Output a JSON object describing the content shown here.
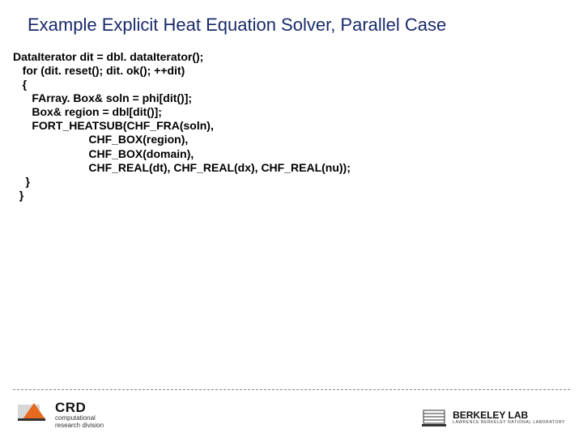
{
  "title": "Example Explicit Heat Equation Solver, Parallel Case",
  "code": {
    "l1": "DataIterator dit = dbl. dataIterator();",
    "l2": "   for (dit. reset(); dit. ok(); ++dit)",
    "l3": "   {",
    "l4": "      FArray. Box& soln = phi[dit()];",
    "l5": "      Box& region = dbl[dit()];",
    "l6": "      FORT_HEATSUB(CHF_FRA(soln),",
    "l7": "                        CHF_BOX(region),",
    "l8": "                        CHF_BOX(domain),",
    "l9": "                        CHF_REAL(dt), CHF_REAL(dx), CHF_REAL(nu));",
    "l10": "    }",
    "l11": "  }"
  },
  "footer": {
    "crd_big": "CRD",
    "crd_sub1": "computational",
    "crd_sub2": "research division",
    "lbl_big": "BERKELEY LAB",
    "lbl_sub": "LAWRENCE BERKELEY NATIONAL LABORATORY"
  }
}
